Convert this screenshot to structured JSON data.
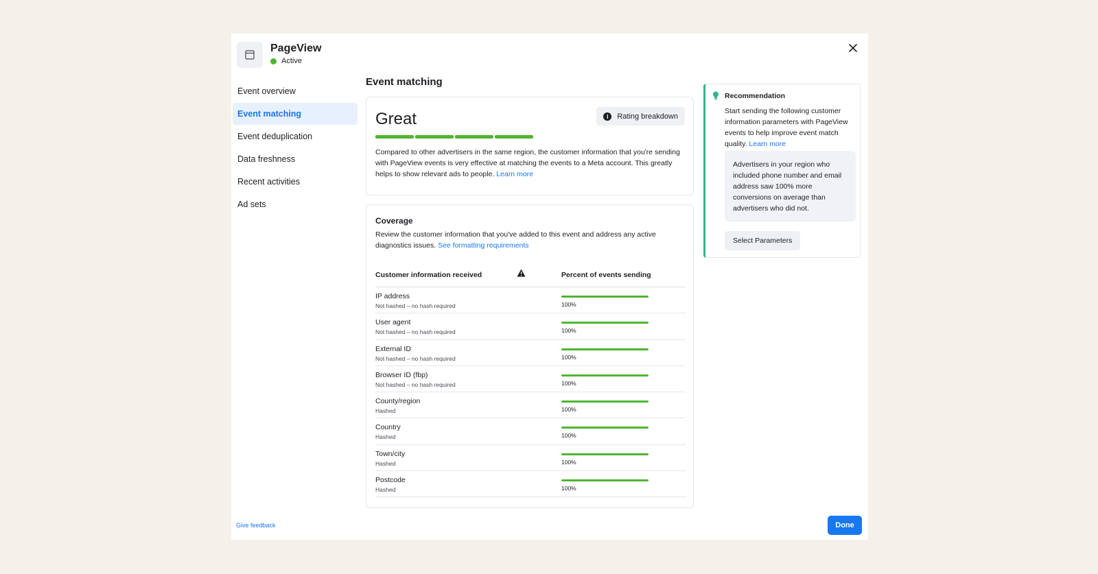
{
  "header": {
    "title": "PageView",
    "status": "Active",
    "status_color": "#4fb531"
  },
  "sidebar": {
    "items": [
      {
        "label": "Event overview",
        "active": false
      },
      {
        "label": "Event matching",
        "active": true
      },
      {
        "label": "Event deduplication",
        "active": false
      },
      {
        "label": "Data freshness",
        "active": false
      },
      {
        "label": "Recent activities",
        "active": false
      },
      {
        "label": "Ad sets",
        "active": false
      }
    ]
  },
  "main": {
    "section_title": "Event matching",
    "score": {
      "label": "Great",
      "segments_filled": 4,
      "segments_total": 4,
      "rating_button": "Rating breakdown",
      "description": "Compared to other advertisers in the same region, the customer information that you're sending with PageView events is very effective at matching the events to a Meta account. This greatly helps to show relevant ads to people.",
      "learn_more": "Learn more"
    },
    "coverage": {
      "title": "Coverage",
      "description": "Review the customer information that you've added to this event and address any active diagnostics issues.",
      "link": "See formatting requirements",
      "col_left": "Customer information received",
      "col_right": "Percent of events sending",
      "rows": [
        {
          "name": "IP address",
          "sub": "Not hashed – no hash required",
          "pct": "100%",
          "value": 1.0
        },
        {
          "name": "User agent",
          "sub": "Not hashed – no hash required",
          "pct": "100%",
          "value": 1.0
        },
        {
          "name": "External ID",
          "sub": "Not hashed – no hash required",
          "pct": "100%",
          "value": 1.0
        },
        {
          "name": "Browser ID (fbp)",
          "sub": "Not hashed – no hash required",
          "pct": "100%",
          "value": 1.0
        },
        {
          "name": "County/region",
          "sub": "Hashed",
          "pct": "100%",
          "value": 1.0
        },
        {
          "name": "Country",
          "sub": "Hashed",
          "pct": "100%",
          "value": 1.0
        },
        {
          "name": "Town/city",
          "sub": "Hashed",
          "pct": "100%",
          "value": 1.0
        },
        {
          "name": "Postcode",
          "sub": "Hashed",
          "pct": "100%",
          "value": 1.0
        }
      ]
    }
  },
  "recommendation": {
    "title": "Recommendation",
    "description": "Start sending the following customer information parameters with PageView events to help improve event match quality.",
    "learn_more": "Learn more",
    "box_text": "Advertisers in your region who included phone number and email address saw 100% more conversions on average than advertisers who did not.",
    "button": "Select Parameters",
    "accent": "#37b28c"
  },
  "footer": {
    "feedback": "Give feedback",
    "done": "Done"
  },
  "colors": {
    "accent": "#1877f2",
    "success": "#4fb531"
  }
}
